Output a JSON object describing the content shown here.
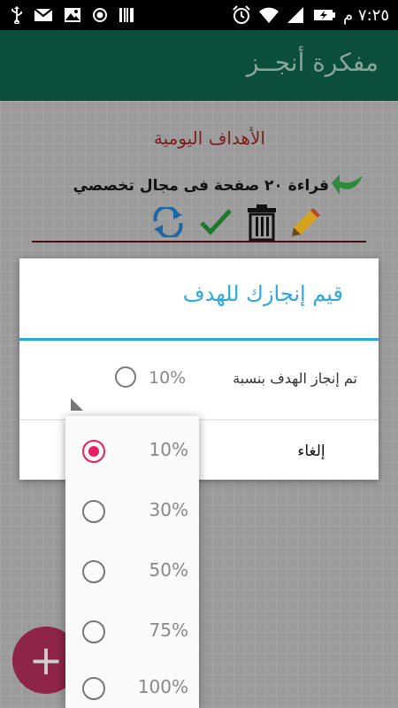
{
  "status_bar": {
    "time": "٧:٢٥ م",
    "icons": [
      "usb-icon",
      "gmail-icon",
      "image-icon",
      "record-icon",
      "barcode-icon",
      "alarm-icon",
      "wifi-icon",
      "signal-icon",
      "battery-charging-icon"
    ]
  },
  "app_bar": {
    "title": "مفكرة أنجــز"
  },
  "background": {
    "section_title": "الأهداف اليومية",
    "goal_text": "قراءة ٢٠ صفحة فى مجال تخصصي",
    "actions": [
      "repeat-icon",
      "check-icon",
      "trash-icon",
      "pencil-icon"
    ],
    "fab_label": "+"
  },
  "dialog": {
    "title": "قيم إنجازك للهدف",
    "row_label": "تم إنجاز الهدف بنسبة",
    "row_value": "10%",
    "cancel_label": "إلغاء"
  },
  "dropdown": {
    "selected": "10%",
    "options": [
      "10%",
      "30%",
      "50%",
      "75%",
      "100%"
    ]
  },
  "colors": {
    "app_bar": "#0b4e3c",
    "accent_blue": "#29a9dd",
    "radio_selected": "#e91e63",
    "section_title": "#7e1d1d",
    "fab": "#8e2448"
  }
}
